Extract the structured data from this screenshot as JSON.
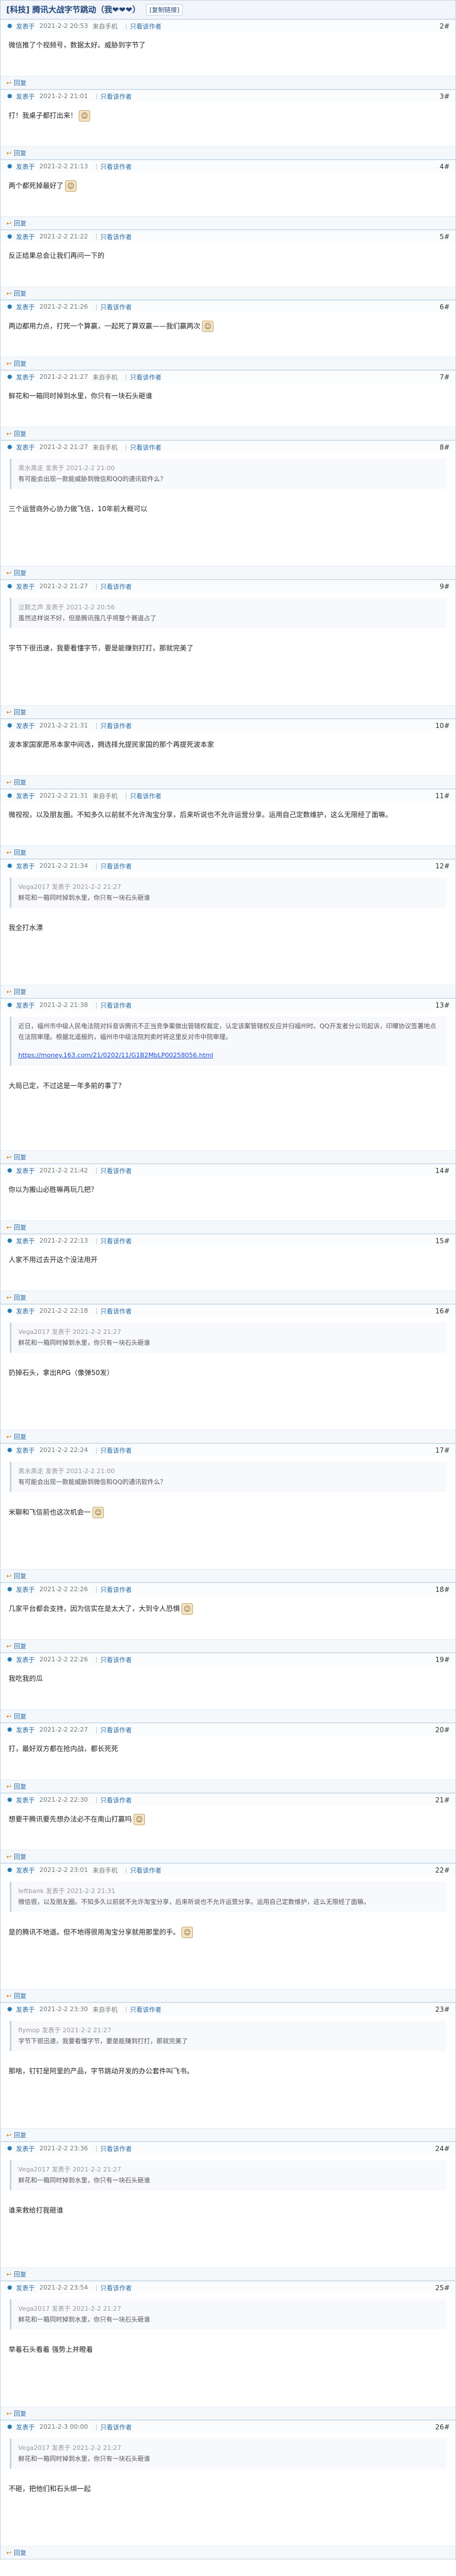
{
  "thread": {
    "title": "[科技] 腾讯大战字节跳动（我❤❤❤）",
    "tag": "[复制链接]"
  },
  "labels": {
    "only_author": "只看该作者",
    "reply": "回复",
    "report": "举报"
  },
  "posts": [
    {
      "author": "发表于",
      "date": "2021-2-2 20:53",
      "via": "来自手机",
      "floor": "2#",
      "body": "微信推了个视频号，数据太好。威胁到字节了"
    },
    {
      "author": "发表于",
      "date": "2021-2-2 21:01",
      "via": "",
      "floor": "3#",
      "body": "打！我桌子都打出来！"
    },
    {
      "author": "发表于",
      "date": "2021-2-2 21:13",
      "via": "",
      "floor": "4#",
      "body": "两个都死掉最好了"
    },
    {
      "author": "发表于",
      "date": "2021-2-2 21:22",
      "via": "",
      "floor": "5#",
      "body": "反正结果总会让我们再问一下的"
    },
    {
      "author": "发表于",
      "date": "2021-2-2 21:26",
      "via": "",
      "floor": "6#",
      "body": "两边都用力点，打死一个算赢，一起死了算双赢——我们赢两次"
    },
    {
      "author": "发表于",
      "date": "2021-2-2 21:27",
      "via": "来自手机",
      "floor": "7#",
      "body": "鲜花和一箱同时掉到水里，你只有一块石头砸谁"
    },
    {
      "author": "发表于",
      "date": "2021-2-2 21:27",
      "via": "来自手机",
      "floor": "8#",
      "quote_meta": "黑水黑走 发表于 2021-2-2 21:00",
      "quote": "有可能会出现一款能威胁到微信和QQ的通讯软件么？",
      "body": "三个运营商外心协力做飞信，10年前大概可以"
    },
    {
      "author": "发表于",
      "date": "2021-2-2 21:27",
      "via": "",
      "floor": "9#",
      "quote_meta": "泣默之声 发表于 2021-2-2 20:56",
      "quote": "虽然这样说不好，但是腾讯强几乎将整个赛道占了",
      "body": "字节下很迅速，我要看懂字节，要是能赚到打打，那就完美了"
    },
    {
      "author": "发表于",
      "date": "2021-2-2 21:31",
      "via": "",
      "floor": "10#",
      "body": "波本家国家愿吊本家中间选，拥选择允提民家国的那个再提死波本家"
    },
    {
      "author": "发表于",
      "date": "2021-2-2 21:31",
      "via": "来自手机",
      "floor": "11#",
      "body": "微视视，以及朋友圈。不知多久以前就不允许淘宝分享，后来听说也不允许运营分享。运用自己定数维护，这么无限经了面嘛。"
    },
    {
      "author": "发表于",
      "date": "2021-2-2 21:34",
      "via": "",
      "floor": "12#",
      "quote_meta": "Vega2017 发表于 2021-2-2 21:27",
      "quote": "鲜花和一箱同时掉到水里，你只有一块石头砸谁",
      "body": "我全打水漂"
    },
    {
      "author": "发表于",
      "date": "2021-2-2 21:38",
      "via": "",
      "floor": "13#",
      "quote_meta": "",
      "quote": "近日，福州市中级人民电法院对抖音诉腾讯不正当竞争案做出管辖权裁定，认定该案管辖权反应并归福州时。QQ开发者分公司起诉，印曝协议签署地点在法院审理。根据北遥报的，福州市中级法院判卖时将这里反对市中院审理。",
      "link": "https://money.163.com/21/0202/11/G1B2MbLP00258056.html",
      "body": "大局已定，不过这是一年多前的事了？"
    },
    {
      "author": "发表于",
      "date": "2021-2-2 21:42",
      "via": "",
      "floor": "14#",
      "body": "你以为搬山必胜嘛再玩几把？"
    },
    {
      "author": "发表于",
      "date": "2021-2-2 22:13",
      "via": "",
      "floor": "15#",
      "body": "人家不用过去开这个没法用开"
    },
    {
      "author": "发表于",
      "date": "2021-2-2 22:18",
      "via": "",
      "floor": "16#",
      "quote_meta": "Vega2017 发表于 2021-2-2 21:27",
      "quote": "鲜花和一箱同时掉到水里，你只有一块石头砸谁",
      "body": "扔掉石头，拿出RPG（像弹50发）"
    },
    {
      "author": "发表于",
      "date": "2021-2-2 22:24",
      "via": "",
      "floor": "17#",
      "quote_meta": "黑水黑走 发表于 2021-2-2 21:00",
      "quote": "有可能会出现一款能威胁到微信和QQ的通讯软件么？",
      "body": "米聊和飞信前也这次机会一"
    },
    {
      "author": "发表于",
      "date": "2021-2-2 22:26",
      "via": "",
      "floor": "18#",
      "body": "几家平台都会支持，因为信实在是太大了，大到令人恐惧"
    },
    {
      "author": "发表于",
      "date": "2021-2-2 22:26",
      "via": "",
      "floor": "19#",
      "body": "我吃我的瓜"
    },
    {
      "author": "发表于",
      "date": "2021-2-2 22:27",
      "via": "",
      "floor": "20#",
      "body": "打，最好双方都在抢内战，都长死死"
    },
    {
      "author": "发表于",
      "date": "2021-2-2 22:30",
      "via": "",
      "floor": "21#",
      "body": "想要干腾讯要先想办法必不在南山打赢吗"
    },
    {
      "author": "发表于",
      "date": "2021-2-2 23:01",
      "via": "来自手机",
      "floor": "22#",
      "quote_meta": "leftbank 发表于 2021-2-2 21:31",
      "quote": "微信很，以及朋友圈。不知多久以前就不允许淘宝分享，后来听说也不允许运营分享。运用自己定数维护，这么无限经了面嘛。",
      "body": "是的腾讯不地道。但不地得很用淘宝分享就用那里的手。"
    },
    {
      "author": "发表于",
      "date": "2021-2-2 23:30",
      "via": "来自手机",
      "floor": "23#",
      "quote_meta": "flymop 发表于 2021-2-2 21:27",
      "quote": "字节下很迅速，我要看懂字节，要是能赚到打打，那就完美了",
      "body": "那啥，钉钉是阿里的产品，字节跳动开发的办公套件叫飞书。"
    },
    {
      "author": "发表于",
      "date": "2021-2-2 23:36",
      "via": "",
      "floor": "24#",
      "quote_meta": "Vega2017 发表于 2021-2-2 21:27",
      "quote": "鲜花和一箱同时掉到水里，你只有一块石头砸谁",
      "body": "谁来救给打我砸谁"
    },
    {
      "author": "发表于",
      "date": "2021-2-2 23:54",
      "via": "",
      "floor": "25#",
      "quote_meta": "Vega2017 发表于 2021-2-2 21:27",
      "quote": "鲜花和一箱同时掉到水里，你只有一块石头砸谁",
      "body": "举着石头看着 强势上并瞪着"
    },
    {
      "author": "发表于",
      "date": "2021-2-3 00:00",
      "via": "",
      "floor": "26#",
      "quote_meta": "Vega2017 发表于 2021-2-2 21:27",
      "quote": "鲜花和一箱同时掉到水里，你只有一块石头砸谁",
      "body": "不砸，把他们和石头绑一起"
    }
  ]
}
